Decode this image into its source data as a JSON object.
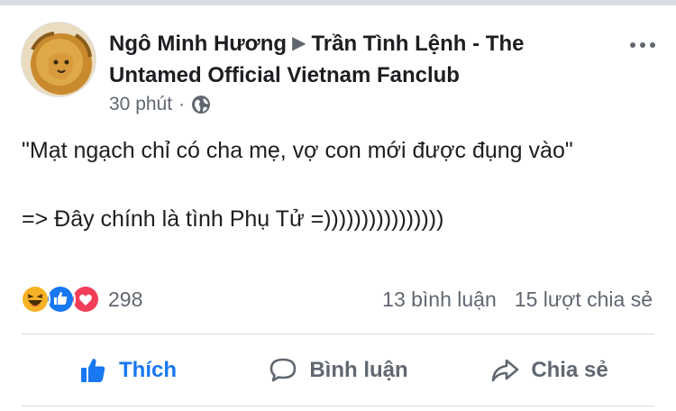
{
  "post": {
    "author": "Ngô Minh Hương",
    "group": "Trần Tình Lệnh - The Untamed Official Vietnam Fanclub",
    "time": "30 phút",
    "separator": "·",
    "privacy_icon": "globe-icon",
    "text": "\"Mạt ngạch chỉ có cha mẹ, vợ con mới được đụng vào\"\n\n=> Đây chính là tình Phụ Tử =))))))))))))))))",
    "more_icon": "more-options-icon"
  },
  "reactions": {
    "icons": [
      "haha-icon",
      "like-icon",
      "love-icon"
    ],
    "count": "298"
  },
  "stats": {
    "comments": "13 bình luận",
    "shares": "15 lượt chia sẻ"
  },
  "actions": {
    "like": "Thích",
    "comment": "Bình luận",
    "share": "Chia sẻ"
  },
  "colors": {
    "accent": "#1877f2",
    "secondary_text": "#606770",
    "love": "#f33e58",
    "haha": "#f7b125"
  }
}
